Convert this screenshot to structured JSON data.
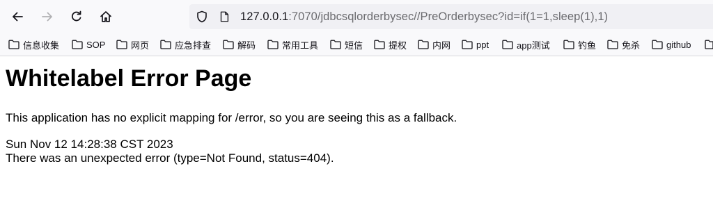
{
  "browser": {
    "url_host": "127.0.0.1",
    "url_rest": ":7070/jdbcsqlorderbysec//PreOrderbysec?id=if(1=1,sleep(1),1)"
  },
  "bookmarks": [
    {
      "label": "信息收集"
    },
    {
      "label": "SOP"
    },
    {
      "label": "网页"
    },
    {
      "label": "应急排查"
    },
    {
      "label": "解码"
    },
    {
      "label": "常用工具"
    },
    {
      "label": "短信"
    },
    {
      "label": "提权"
    },
    {
      "label": "内网"
    },
    {
      "label": "ppt"
    },
    {
      "label": "app测试"
    },
    {
      "label": "钓鱼"
    },
    {
      "label": "免杀"
    },
    {
      "label": "github"
    }
  ],
  "page": {
    "title": "Whitelabel Error Page",
    "message": "This application has no explicit mapping for /error, so you are seeing this as a fallback.",
    "timestamp": "Sun Nov 12 14:28:38 CST 2023",
    "error": "There was an unexpected error (type=Not Found, status=404)."
  }
}
